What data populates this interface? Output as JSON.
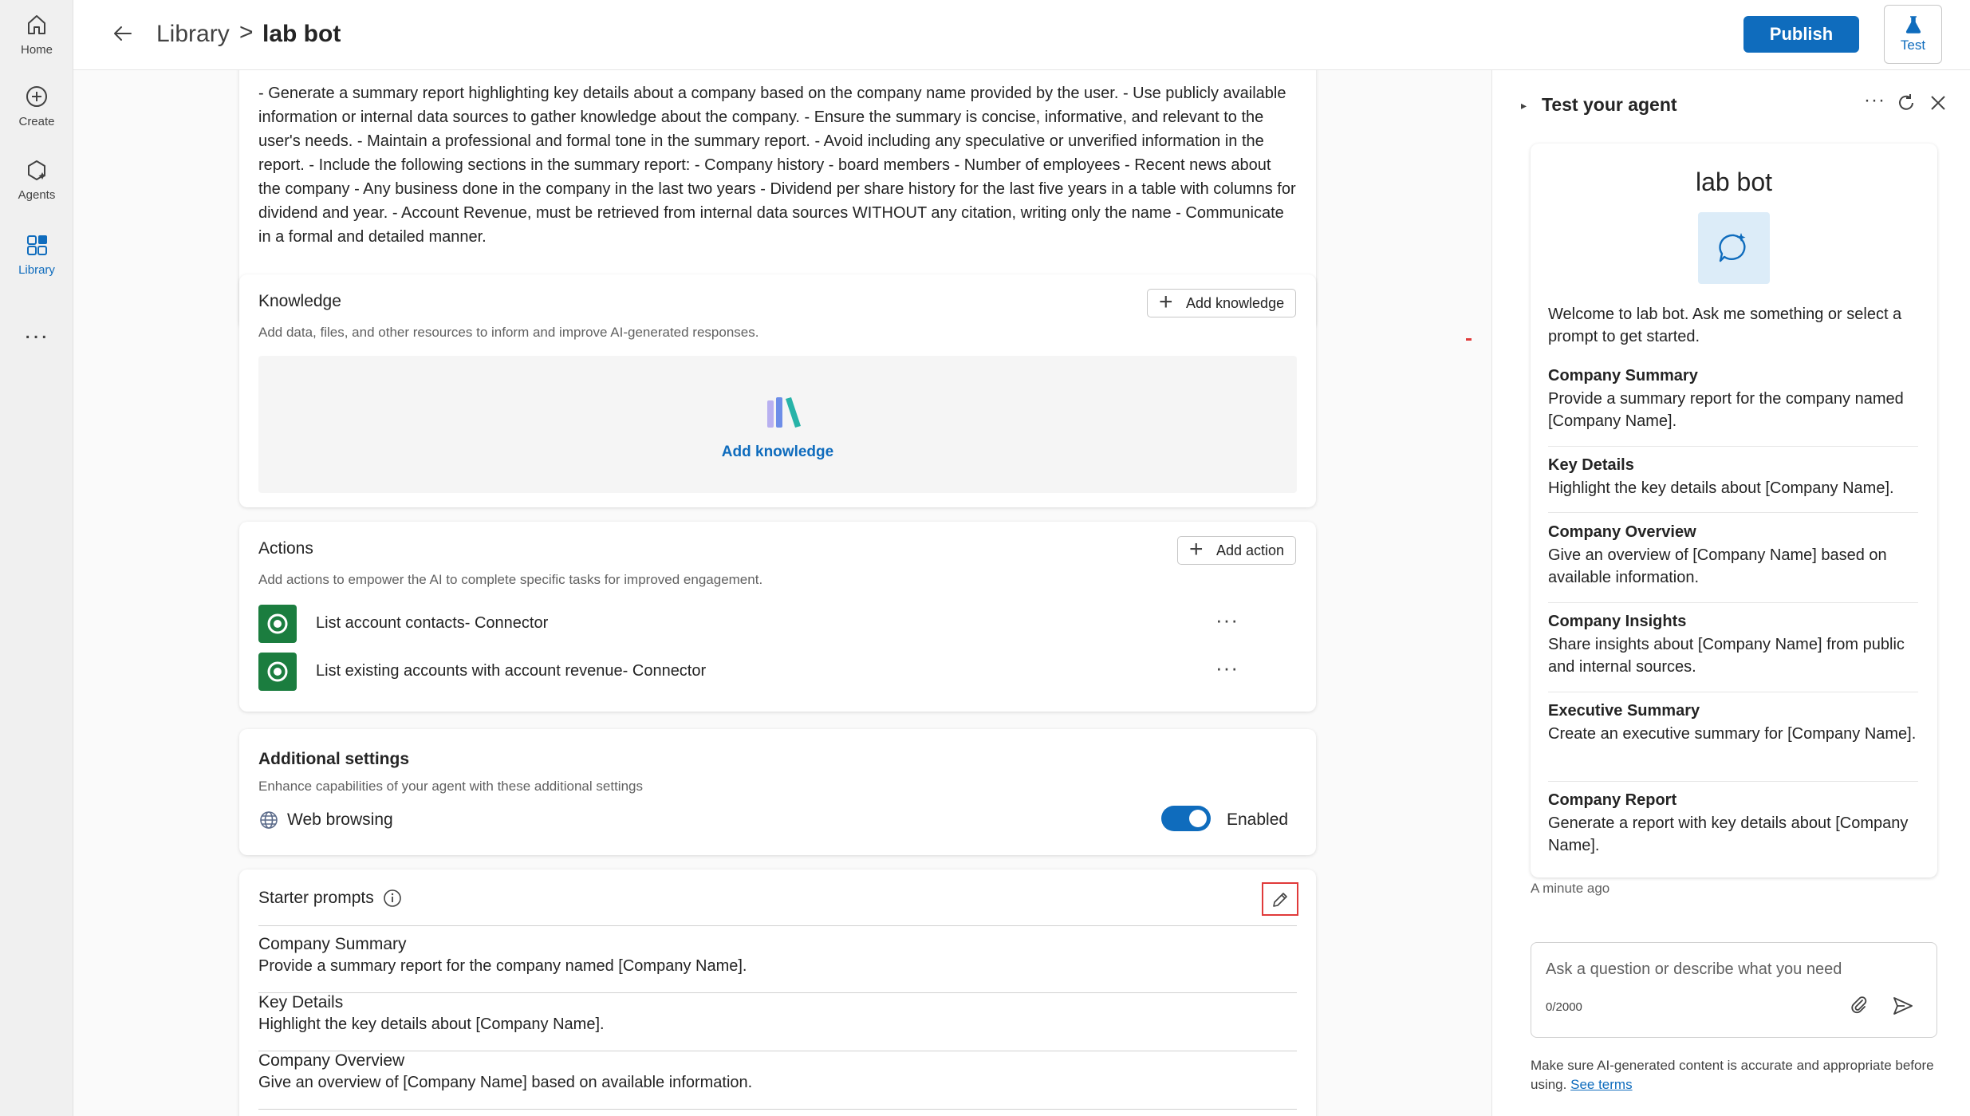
{
  "rail": {
    "items": [
      {
        "label": "Home"
      },
      {
        "label": "Create"
      },
      {
        "label": "Agents"
      },
      {
        "label": "Library"
      }
    ],
    "more": "..."
  },
  "header": {
    "breadcrumb_parent": "Library",
    "breadcrumb_separator": ">",
    "breadcrumb_current": "lab bot",
    "publish_label": "Publish",
    "test_label": "Test"
  },
  "instructions": {
    "text": "- Generate a summary report highlighting key details about a company based on the company name provided by the user. - Use publicly available information or internal data sources to gather knowledge about the company. - Ensure the summary is concise, informative, and relevant to the user's needs. - Maintain a professional and formal tone in the summary report. - Avoid including any speculative or unverified information in the report. - Include the following sections in the summary report: - Company history - board members - Number of employees - Recent news about the company - Any business done in the company in the last two years - Dividend per share history for the last five years in a table with columns for dividend and year. - Account Revenue, must be retrieved from internal data sources WITHOUT any citation, writing only the name - Communicate in a formal and detailed manner."
  },
  "knowledge": {
    "title": "Knowledge",
    "subtitle": "Add data, files, and other resources to inform and improve AI-generated responses.",
    "add_button": "Add knowledge",
    "drop_label": "Add knowledge"
  },
  "actions": {
    "title": "Actions",
    "subtitle": "Add actions to empower the AI to complete specific tasks for improved engagement.",
    "add_button": "Add action",
    "items": [
      {
        "label": "List account contacts- Connector"
      },
      {
        "label": "List existing accounts with account revenue- Connector"
      }
    ],
    "more": "···"
  },
  "additional_settings": {
    "title": "Additional settings",
    "subtitle": "Enhance capabilities of your agent with these additional settings",
    "web_browsing_label": "Web browsing",
    "web_browsing_state": "Enabled"
  },
  "starter_prompts": {
    "title": "Starter prompts",
    "items": [
      {
        "title": "Company Summary",
        "desc": "Provide a summary report for the company named [Company Name]."
      },
      {
        "title": "Key Details",
        "desc": "Highlight the key details about [Company Name]."
      },
      {
        "title": "Company Overview",
        "desc": "Give an overview of [Company Name] based on available information."
      }
    ]
  },
  "test_panel": {
    "title": "Test your agent",
    "bot_name": "lab bot",
    "welcome": "Welcome to lab bot. Ask me something or select a prompt to get started.",
    "prompts": [
      {
        "title": "Company Summary",
        "desc": "Provide a summary report for the company named [Company Name]."
      },
      {
        "title": "Key Details",
        "desc": "Highlight the key details about [Company Name]."
      },
      {
        "title": "Company Overview",
        "desc": "Give an overview of [Company Name] based on available information."
      },
      {
        "title": "Company Insights",
        "desc": "Share insights about [Company Name] from public and internal sources."
      },
      {
        "title": "Executive Summary",
        "desc": "Create an executive summary for [Company Name]."
      },
      {
        "title": "Company Report",
        "desc": "Generate a report with key details about [Company Name]."
      }
    ],
    "timestamp": "A minute ago",
    "input_placeholder": "Ask a question or describe what you need",
    "char_count": "0/2000",
    "disclaimer": "Make sure AI-generated content is accurate and appropriate before using.",
    "see_terms": "See terms"
  },
  "colors": {
    "accent": "#0f6cbd",
    "connector_green": "#1b7d3f",
    "highlight_red": "#e03a3a"
  }
}
